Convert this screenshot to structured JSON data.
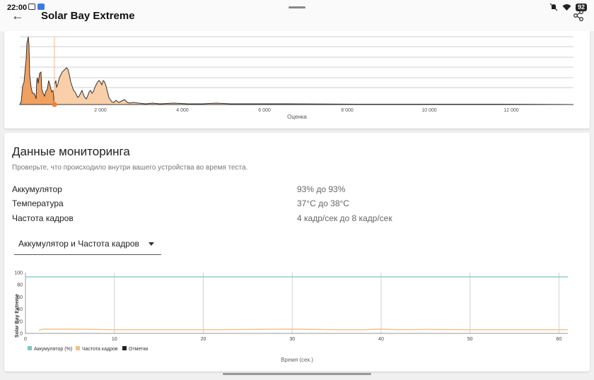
{
  "status": {
    "time": "22:00",
    "battery": "92"
  },
  "header": {
    "title": "Solar Bay Extreme"
  },
  "histogram": {
    "xlabel": "Оценка",
    "ticks": [
      "2 000",
      "4 000",
      "6 000",
      "8 000",
      "10 000",
      "12 000"
    ],
    "colors": {
      "dark": "#f0a060",
      "light": "#f8cfa8",
      "line": "#333333",
      "marker": "#f08030"
    }
  },
  "monitoring": {
    "title": "Данные мониторинга",
    "subtitle": "Проверьте, что происходило внутри вашего устройства во время теста.",
    "rows": [
      {
        "label": "Аккумулятор",
        "value": "93% до 93%"
      },
      {
        "label": "Температура",
        "value": "37°C до 38°C"
      },
      {
        "label": "Частота кадров",
        "value": "4 кадр/сек до 8 кадр/сек"
      }
    ],
    "dropdown": {
      "selected": "Аккумулятор и Частота кадров"
    }
  },
  "chart_data": {
    "type": "line",
    "xlabel": "Время (сек.)",
    "ylabel": "Solar Bay Extreme",
    "xlim": [
      0,
      61
    ],
    "ylim": [
      0,
      100
    ],
    "x_ticks": [
      0,
      10,
      20,
      30,
      40,
      50,
      60
    ],
    "y_ticks": [
      0,
      20,
      40,
      60,
      80,
      100
    ],
    "series": [
      {
        "name": "Аккумулятор (%)",
        "color": "#7fc4c4",
        "x": [
          0,
          61
        ],
        "y": [
          93,
          93
        ]
      },
      {
        "name": "Частота кадров",
        "color": "#f2c08a",
        "x": [
          1.5,
          2,
          5,
          8,
          10,
          15,
          20,
          25,
          30,
          35,
          38,
          40,
          42,
          45,
          50,
          55,
          58,
          61
        ],
        "y": [
          5,
          7,
          7,
          6.5,
          6,
          6,
          6,
          6.5,
          7,
          6,
          6,
          7,
          6,
          6.5,
          6,
          6,
          6,
          6
        ]
      },
      {
        "name": "Отметки",
        "color": "#222222",
        "x": [],
        "y": []
      }
    ],
    "legend": "bottom-left",
    "grid": true
  }
}
